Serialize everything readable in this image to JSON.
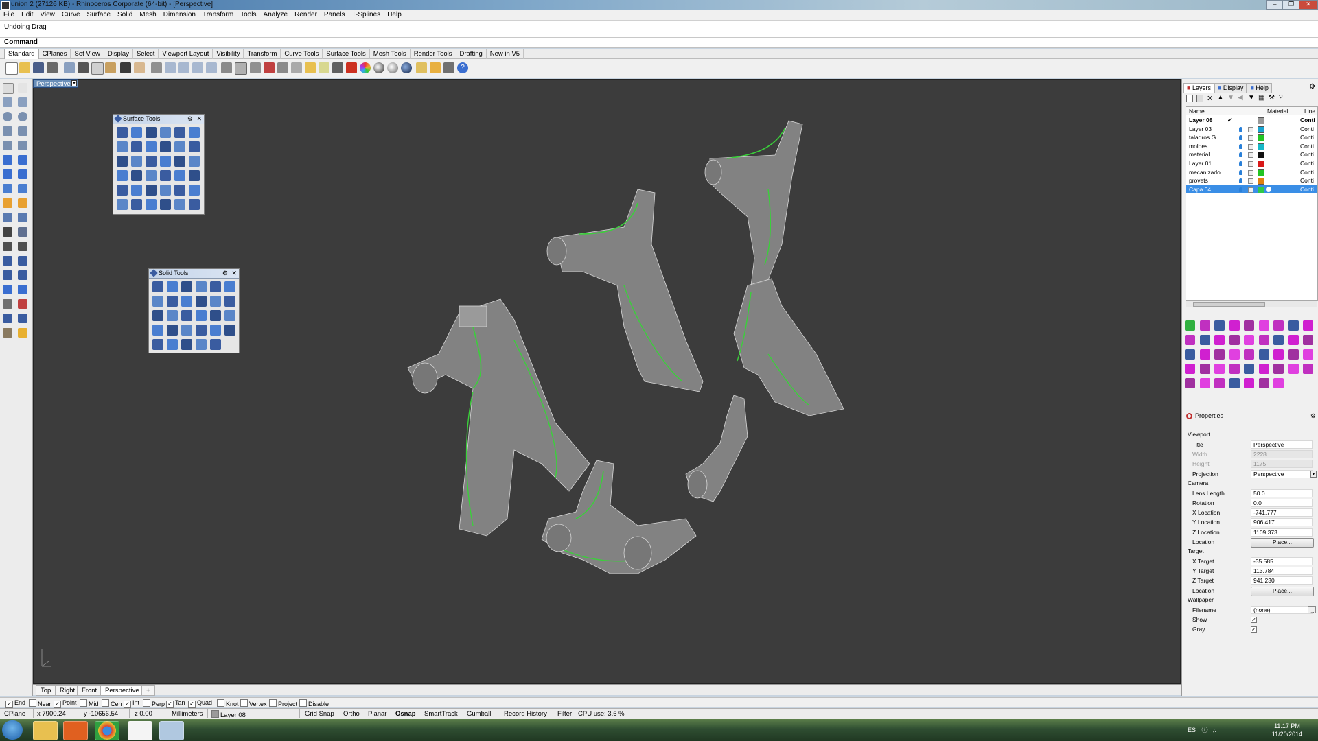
{
  "window": {
    "title": "union 2 (27126 KB) - Rhinoceros Corporate (64-bit) - [Perspective]"
  },
  "menu": [
    "File",
    "Edit",
    "View",
    "Curve",
    "Surface",
    "Solid",
    "Mesh",
    "Dimension",
    "Transform",
    "Tools",
    "Analyze",
    "Render",
    "Panels",
    "T-Splines",
    "Help"
  ],
  "command": {
    "history": "Undoing Drag",
    "label": "Command:",
    "value": ""
  },
  "toolbar_tabs": [
    "Standard",
    "CPlanes",
    "Set View",
    "Display",
    "Select",
    "Viewport Layout",
    "Visibility",
    "Transform",
    "Curve Tools",
    "Surface Tools",
    "Mesh Tools",
    "Render Tools",
    "Drafting",
    "New in V5"
  ],
  "viewport": {
    "label": "Perspective",
    "dropdown": "▾"
  },
  "palettes": {
    "surface_tools": "Surface Tools",
    "solid_tools": "Solid Tools"
  },
  "viewport_tabs": [
    "Top",
    "Right",
    "Front",
    "Perspective"
  ],
  "osnap": [
    {
      "label": "End",
      "checked": true
    },
    {
      "label": "Near",
      "checked": false
    },
    {
      "label": "Point",
      "checked": true
    },
    {
      "label": "Mid",
      "checked": false
    },
    {
      "label": "Cen",
      "checked": false
    },
    {
      "label": "Int",
      "checked": true
    },
    {
      "label": "Perp",
      "checked": false
    },
    {
      "label": "Tan",
      "checked": true
    },
    {
      "label": "Quad",
      "checked": true
    },
    {
      "label": "Knot",
      "checked": false
    },
    {
      "label": "Vertex",
      "checked": false
    },
    {
      "label": "Project",
      "checked": false
    },
    {
      "label": "Disable",
      "checked": false
    }
  ],
  "status": {
    "cplane": "CPlane",
    "x": "x 7900.24",
    "y": "y -10656.54",
    "z": "z 0.00",
    "units": "Millimeters",
    "layer": "Layer 08",
    "toggles": [
      "Grid Snap",
      "Ortho",
      "Planar",
      "Osnap",
      "SmartTrack",
      "Gumball",
      "Record History",
      "Filter"
    ],
    "cpu": "CPU use: 3.6 %"
  },
  "right_panel": {
    "tabs": [
      "Layers",
      "Display",
      "Help"
    ],
    "layer_columns": [
      "Name",
      "Material",
      "Line"
    ],
    "layers": [
      {
        "name": "Layer 08",
        "color": "#9a9a9a",
        "current": true,
        "selected": false,
        "linetype": "Conti"
      },
      {
        "name": "Layer 03",
        "color": "#1aa3d0",
        "current": false,
        "selected": false,
        "linetype": "Conti"
      },
      {
        "name": "taladros G",
        "color": "#22c422",
        "current": false,
        "selected": false,
        "linetype": "Conti"
      },
      {
        "name": "moldes",
        "color": "#18b8c8",
        "current": false,
        "selected": false,
        "linetype": "Conti"
      },
      {
        "name": "material",
        "color": "#111111",
        "current": false,
        "selected": false,
        "linetype": "Conti"
      },
      {
        "name": "Layer 01",
        "color": "#d81818",
        "current": false,
        "selected": false,
        "linetype": "Conti"
      },
      {
        "name": "mecanizado...",
        "color": "#22c422",
        "current": false,
        "selected": false,
        "linetype": "Conti"
      },
      {
        "name": "provets",
        "color": "#e08010",
        "current": false,
        "selected": false,
        "linetype": "Conti"
      },
      {
        "name": "Capa 04",
        "color": "#2ec84a",
        "current": false,
        "selected": true,
        "linetype": "Conti"
      }
    ],
    "properties_title": "Properties",
    "viewport_section": "Viewport",
    "props": [
      {
        "key": "Title",
        "value": "Perspective",
        "disabled": false
      },
      {
        "key": "Width",
        "value": "2228",
        "disabled": true
      },
      {
        "key": "Height",
        "value": "1175",
        "disabled": true
      },
      {
        "key": "Projection",
        "value": "Perspective",
        "disabled": false
      }
    ],
    "camera_section": "Camera",
    "camera": [
      {
        "key": "Lens Length",
        "value": "50.0"
      },
      {
        "key": "Rotation",
        "value": "0.0"
      },
      {
        "key": "X Location",
        "value": "-741.777"
      },
      {
        "key": "Y Location",
        "value": "906.417"
      },
      {
        "key": "Z Location",
        "value": "1109.373"
      }
    ],
    "location_label": "Location",
    "place_button": "Place...",
    "target_section": "Target",
    "target": [
      {
        "key": "X Target",
        "value": "-35.585"
      },
      {
        "key": "Y Target",
        "value": "113.784"
      },
      {
        "key": "Z Target",
        "value": "941.230"
      }
    ],
    "wallpaper_section": "Wallpaper",
    "wallpaper": {
      "filename_label": "Filename",
      "filename": "(none)",
      "show_label": "Show",
      "gray_label": "Gray",
      "show": true,
      "gray": true
    }
  },
  "taskbar": {
    "lang": "ES",
    "time": "11:17 PM",
    "date": "11/20/2014"
  }
}
